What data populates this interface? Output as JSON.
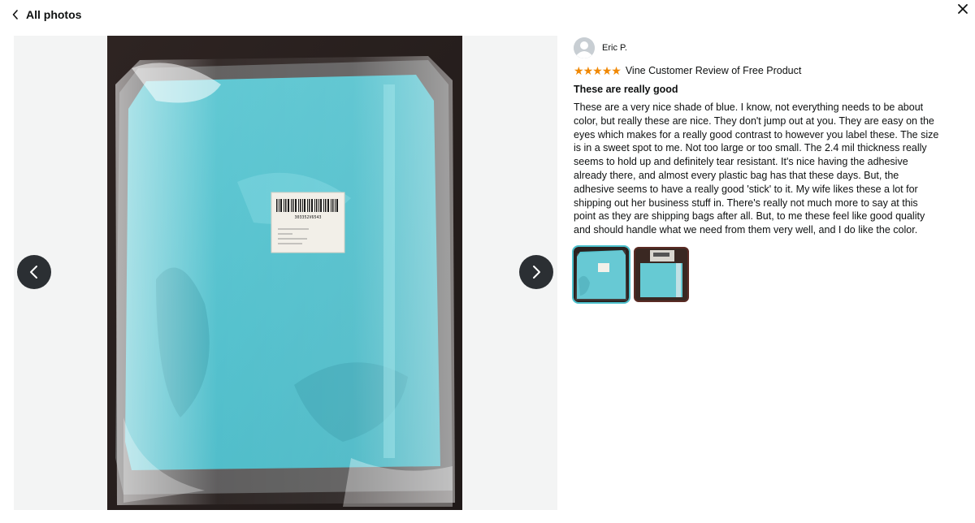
{
  "header": {
    "back_label": "All photos",
    "back_icon": "chevron-left-icon",
    "close_icon": "close-icon"
  },
  "viewer": {
    "prev_icon": "chevron-left-icon",
    "next_icon": "chevron-right-icon",
    "label_barcode_number": "303352V6543"
  },
  "review": {
    "author": "Eric P.",
    "rating_stars": 5,
    "badge": "Vine Customer Review of Free Product",
    "title": "These are really good",
    "body": "These are a very nice shade of blue. I know, not everything needs to be about color, but really these are nice. They don't jump out at you. They are easy on the eyes which makes for a really good contrast to however you label these. The size is in a sweet spot to me. Not too large or too small. The 2.4 mil thickness really seems to hold up and definitely tear resistant. It's nice having the adhesive already there, and almost every plastic bag has that these days. But, the adhesive seems to have a really good 'stick' to it. My wife likes these a lot for shipping out her business stuff in. There's really not much more to say at this point as they are shipping bags after all. But, to me these feel like good quality and should handle what we need from them very well, and I do like the color.",
    "thumbnails": [
      {
        "name": "thumbnail-1",
        "selected": true
      },
      {
        "name": "thumbnail-2",
        "selected": false
      }
    ]
  },
  "colors": {
    "star": "#f08804",
    "active_thumb_outline": "#4bc0cc",
    "bag_blue": "#4fc3cf"
  }
}
